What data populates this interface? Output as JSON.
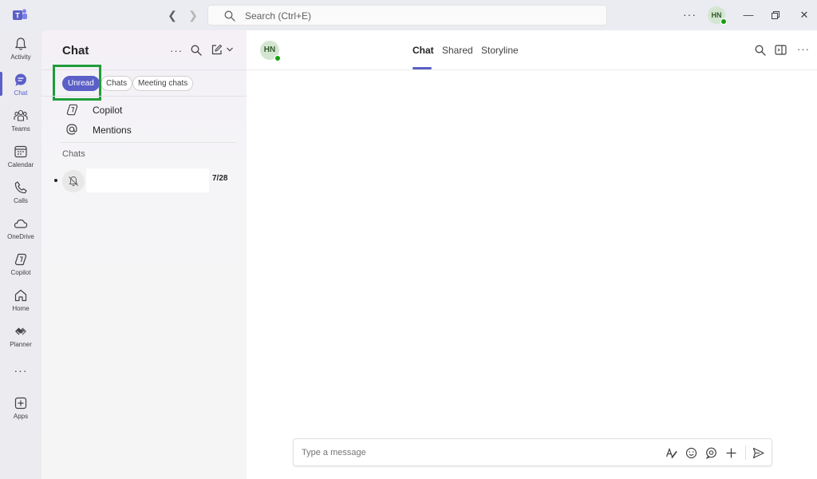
{
  "titlebar": {
    "search_placeholder": "Search (Ctrl+E)",
    "avatar_initials": "HN",
    "more": "···"
  },
  "rail": {
    "items": [
      {
        "label": "Activity",
        "icon": "bell-icon"
      },
      {
        "label": "Chat",
        "icon": "chat-icon",
        "active": true
      },
      {
        "label": "Teams",
        "icon": "teams-icon"
      },
      {
        "label": "Calendar",
        "icon": "calendar-icon"
      },
      {
        "label": "Calls",
        "icon": "phone-icon"
      },
      {
        "label": "OneDrive",
        "icon": "cloud-icon"
      },
      {
        "label": "Copilot",
        "icon": "copilot-icon"
      },
      {
        "label": "Home",
        "icon": "home-icon"
      },
      {
        "label": "Planner",
        "icon": "planner-icon"
      },
      {
        "label": "Apps",
        "icon": "plus-square-icon"
      }
    ],
    "more": "···"
  },
  "chatlist": {
    "title": "Chat",
    "more": "···",
    "filters": [
      "Unread",
      "Chats",
      "Meeting chats"
    ],
    "pinned": [
      {
        "label": "Copilot",
        "icon": "copilot-icon"
      },
      {
        "label": "Mentions",
        "icon": "at-icon"
      }
    ],
    "section_header": "Chats",
    "chats": [
      {
        "name": "",
        "date": "7/28",
        "muted": true
      }
    ]
  },
  "main": {
    "avatar_initials": "HN",
    "tabs": [
      "Chat",
      "Shared",
      "Storyline"
    ],
    "more": "···",
    "compose_placeholder": "Type a message"
  },
  "colors": {
    "accent": "#5b5fc7",
    "presence": "#13a10e",
    "highlight": "#1f9d3a"
  }
}
